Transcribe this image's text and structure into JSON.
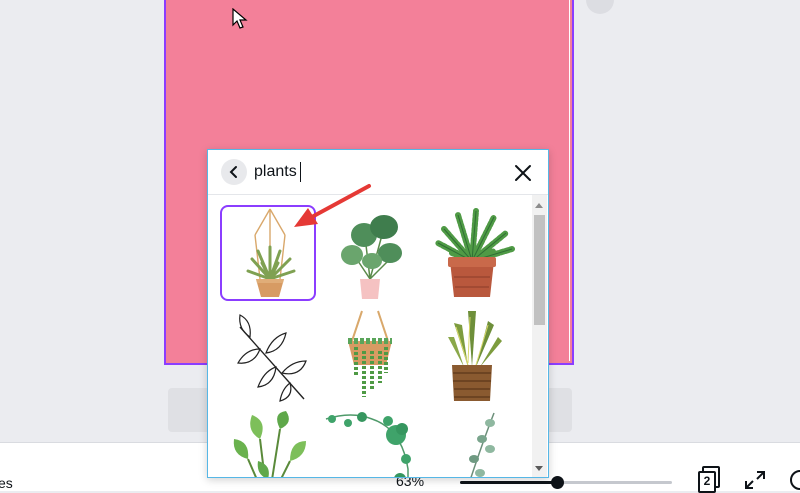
{
  "search": {
    "value": "plants"
  },
  "status_bar": {
    "left_text": "es",
    "zoom_label": "63%",
    "zoom_fraction": 0.63,
    "page_count": "2"
  },
  "results": [
    {
      "icon": "hanging-air-plant-icon",
      "selected": true
    },
    {
      "icon": "monstera-pot-icon",
      "selected": false
    },
    {
      "icon": "fern-terracotta-pot-icon",
      "selected": false
    },
    {
      "icon": "line-art-leaves-icon",
      "selected": false
    },
    {
      "icon": "hanging-string-of-pearls-icon",
      "selected": false
    },
    {
      "icon": "snake-plant-basket-icon",
      "selected": false
    },
    {
      "icon": "pothos-leaves-icon",
      "selected": false
    },
    {
      "icon": "clover-vine-icon",
      "selected": false
    },
    {
      "icon": "eucalyptus-branch-icon",
      "selected": false
    }
  ],
  "colors": {
    "canvas_fill": "#f38099",
    "selection_purple": "#8b3dff",
    "annotation_arrow": "#e53935",
    "popup_border": "#56b7e6"
  }
}
